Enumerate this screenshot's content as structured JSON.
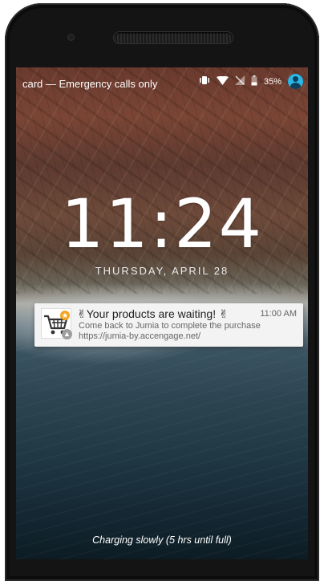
{
  "status_bar": {
    "carrier_text": "card — Emergency calls only",
    "battery_percent": "35%",
    "icons": [
      "vibrate-icon",
      "wifi-icon",
      "no-signal-icon",
      "battery-icon",
      "user-avatar-icon"
    ]
  },
  "lockscreen": {
    "time": "11:24",
    "date": "THURSDAY, APRIL 28",
    "charging_text": "Charging slowly (5 hrs until full)"
  },
  "notification": {
    "title": "✌Your products are waiting! ✌",
    "time": "11:00 AM",
    "body": "Come back to Jumia to complete the purchase",
    "url": "https://jumia-by.accengage.net/",
    "app_icon": "shopping-cart-icon",
    "badge_icon": "app-badge-icon"
  },
  "colors": {
    "accent": "#29b6e8",
    "notification_bg": "#f3f3f3",
    "cart_badge": "#f5a623"
  }
}
